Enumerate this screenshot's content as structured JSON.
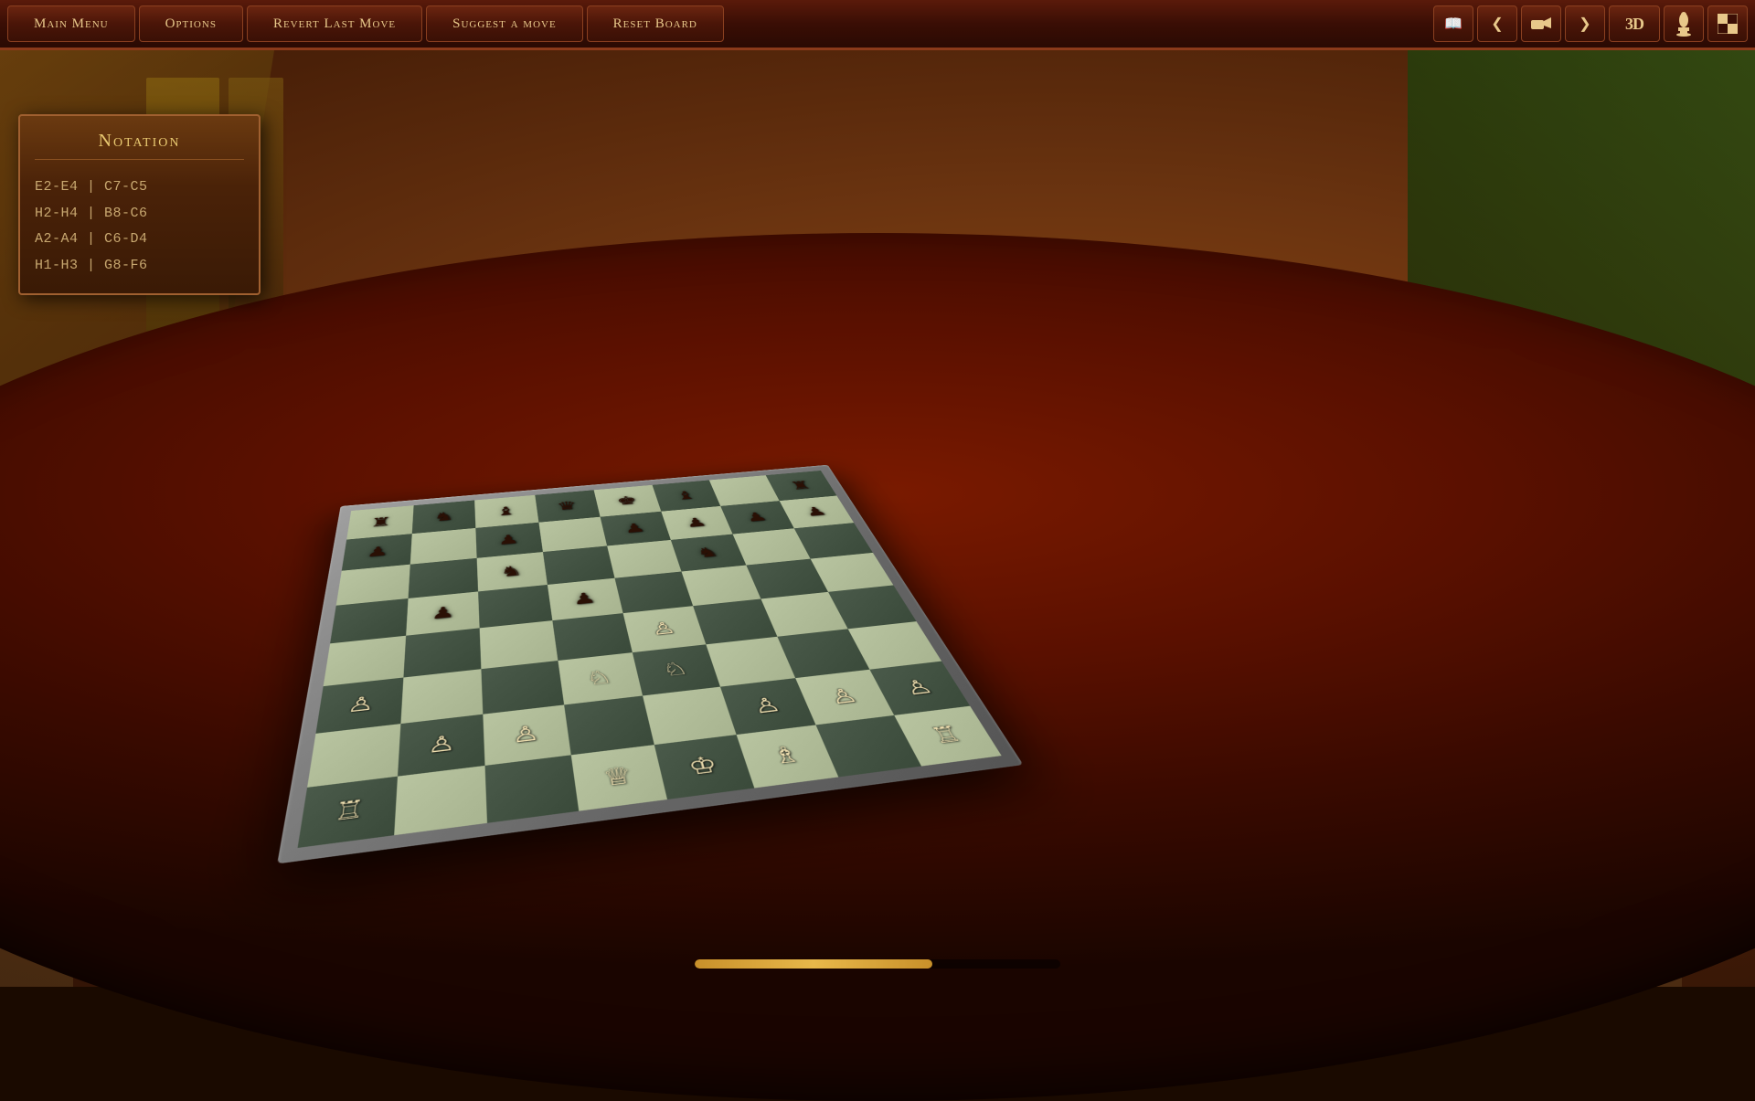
{
  "menubar": {
    "main_menu_label": "Main Menu",
    "options_label": "Options",
    "revert_label": "Revert Last Move",
    "suggest_label": "Suggest a move",
    "reset_label": "Reset Board",
    "icon_book": "📖",
    "icon_prev": "❮",
    "icon_camera": "🎥",
    "icon_next": "❯",
    "icon_3d": "3D",
    "icon_piece": "♞",
    "icon_board": "⊞"
  },
  "notation": {
    "title": "Notation",
    "moves": [
      "E2-E4 | C7-C5",
      "H2-H4 | B8-C6",
      "A2-A4 | C6-D4",
      "H1-H3 | G8-F6"
    ]
  },
  "progress": {
    "value": 65,
    "max": 100
  },
  "board": {
    "pieces": {
      "white": {
        "king": "♔",
        "queen": "♕",
        "rook": "♖",
        "bishop": "♗",
        "knight": "♘",
        "pawn": "♙"
      },
      "black": {
        "king": "♚",
        "queen": "♛",
        "rook": "♜",
        "bishop": "♝",
        "knight": "♞",
        "pawn": "♟"
      }
    }
  }
}
